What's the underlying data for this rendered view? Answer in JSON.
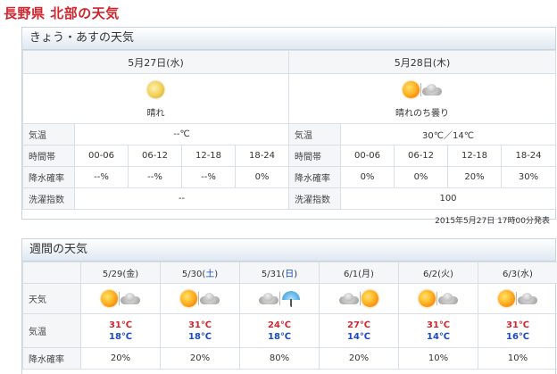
{
  "title": "長野県 北部の天気",
  "today": {
    "header": "きょう・あすの天気",
    "labels": {
      "temp": "気温",
      "time": "時間帯",
      "rain": "降水確率",
      "wash": "洗濯指数"
    },
    "days": [
      {
        "date": "5月27日(水)",
        "weather": "晴れ",
        "temp": "--℃",
        "times": [
          "00-06",
          "06-12",
          "12-18",
          "18-24"
        ],
        "rain": [
          "--%",
          "--%",
          "--%",
          "0%"
        ],
        "wash": "--"
      },
      {
        "date": "5月28日(木)",
        "weather": "晴れのち曇り",
        "temp": "30℃／14℃",
        "times": [
          "00-06",
          "06-12",
          "12-18",
          "18-24"
        ],
        "rain": [
          "0%",
          "0%",
          "20%",
          "30%"
        ],
        "wash": "100"
      }
    ],
    "issued": "2015年5月27日 17時00分発表"
  },
  "week": {
    "header": "週間の天気",
    "labels": {
      "weather": "天気",
      "temp": "気温",
      "rain": "降水確率"
    },
    "days": [
      {
        "date_pre": "5/29(",
        "dow": "金",
        "date_post": ")",
        "icons": [
          "sun",
          "cloud"
        ],
        "high": "31℃",
        "low": "18℃",
        "rain": "20%"
      },
      {
        "date_pre": "5/30(",
        "dow": "土",
        "date_post": ")",
        "icons": [
          "sun",
          "cloud"
        ],
        "high": "31℃",
        "low": "18℃",
        "rain": "20%"
      },
      {
        "date_pre": "5/31(",
        "dow": "日",
        "date_post": ")",
        "icons": [
          "cloud",
          "umbrella"
        ],
        "high": "24℃",
        "low": "18℃",
        "rain": "80%"
      },
      {
        "date_pre": "6/1(",
        "dow": "月",
        "date_post": ")",
        "icons": [
          "cloud",
          "sun"
        ],
        "high": "27℃",
        "low": "14℃",
        "rain": "20%"
      },
      {
        "date_pre": "6/2(",
        "dow": "火",
        "date_post": ")",
        "icons": [
          "sun",
          "cloud"
        ],
        "high": "31℃",
        "low": "14℃",
        "rain": "10%"
      },
      {
        "date_pre": "6/3(",
        "dow": "水",
        "date_post": ")",
        "icons": [
          "sun",
          "cloud"
        ],
        "high": "31℃",
        "low": "16℃",
        "rain": "10%"
      }
    ]
  },
  "colors": {
    "title": "#d2262f",
    "high": "#d2262f",
    "low": "#1a49c4",
    "header_bg": "#dfe8f1"
  }
}
